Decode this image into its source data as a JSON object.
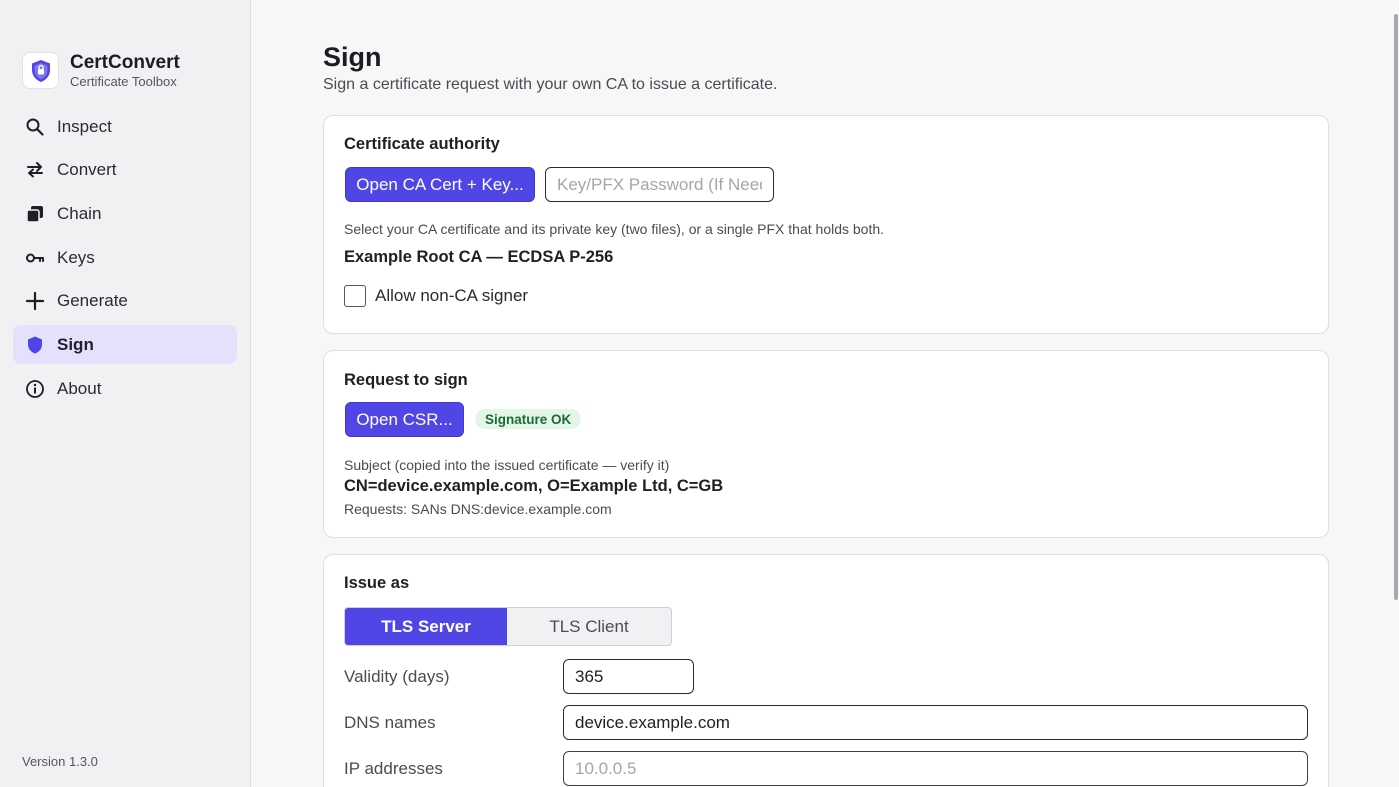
{
  "app": {
    "name": "CertConvert",
    "subtitle": "Certificate Toolbox",
    "version": "Version 1.3.0"
  },
  "sidebar": {
    "items": [
      {
        "label": "Inspect",
        "icon": "search-icon"
      },
      {
        "label": "Convert",
        "icon": "swap-arrows-icon"
      },
      {
        "label": "Chain",
        "icon": "stacked-layers-icon"
      },
      {
        "label": "Keys",
        "icon": "key-icon"
      },
      {
        "label": "Generate",
        "icon": "plus-icon"
      },
      {
        "label": "Sign",
        "icon": "shield-icon",
        "active": true
      },
      {
        "label": "About",
        "icon": "info-icon"
      }
    ]
  },
  "page": {
    "title": "Sign",
    "subtitle": "Sign a certificate request with your own CA to issue a certificate."
  },
  "ca_card": {
    "title": "Certificate authority",
    "open_button": "Open CA Cert + Key...",
    "password_placeholder": "Key/PFX Password (If Needed)",
    "help": "Select your CA certificate and its private key (two files), or a single PFX that holds both.",
    "selected_ca": "Example Root CA — ECDSA P-256",
    "allow_non_ca_label": "Allow non-CA signer",
    "allow_non_ca_checked": false
  },
  "request_card": {
    "title": "Request to sign",
    "open_button": "Open CSR...",
    "status_badge": "Signature OK",
    "subject_help": "Subject (copied into the issued certificate — verify it)",
    "subject": "CN=device.example.com, O=Example Ltd, C=GB",
    "requests": "Requests: SANs DNS:device.example.com"
  },
  "issue_card": {
    "title": "Issue as",
    "profiles": [
      "TLS Server",
      "TLS Client"
    ],
    "selected_profile": "TLS Server",
    "validity_label": "Validity (days)",
    "validity_value": "365",
    "dns_label": "DNS names",
    "dns_value": "device.example.com",
    "ip_label": "IP addresses",
    "ip_placeholder": "10.0.0.5"
  },
  "colors": {
    "accent": "#4f46e5",
    "active_nav_bg": "#e3e1fb",
    "badge_bg": "#e3f6e8",
    "badge_text": "#1d6b35"
  }
}
